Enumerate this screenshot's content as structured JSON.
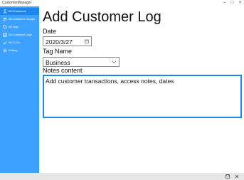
{
  "window": {
    "title": "CustomerManager",
    "minimize": "–",
    "maximize": "□",
    "close": "×"
  },
  "sidebar": {
    "items": [
      {
        "label": "All Customers",
        "icon": "people-icon",
        "active": true
      },
      {
        "label": "All Customer Groups",
        "icon": "group-icon",
        "active": false
      },
      {
        "label": "All Tags",
        "icon": "tag-icon",
        "active": false
      },
      {
        "label": "All Customer Logs",
        "icon": "log-icon",
        "active": false
      },
      {
        "label": "All To Do",
        "icon": "todo-icon",
        "active": false
      },
      {
        "label": "Setting",
        "icon": "gear-icon",
        "active": false
      }
    ]
  },
  "main": {
    "title": "Add Customer Log",
    "date": {
      "label": "Date",
      "value": "2020/3/27"
    },
    "tag": {
      "label": "Tag Name",
      "value": "Business"
    },
    "notes": {
      "label": "Notes content",
      "value": "Add customer transactions, access notes, dates"
    }
  },
  "statusbar": {
    "icons": [
      "save-icon",
      "close-icon"
    ]
  },
  "colors": {
    "sidebar": "#3da2ff",
    "sidebar_active": "#1f86f0",
    "accent": "#1f86f0",
    "statusbar": "#e6e6e6"
  }
}
